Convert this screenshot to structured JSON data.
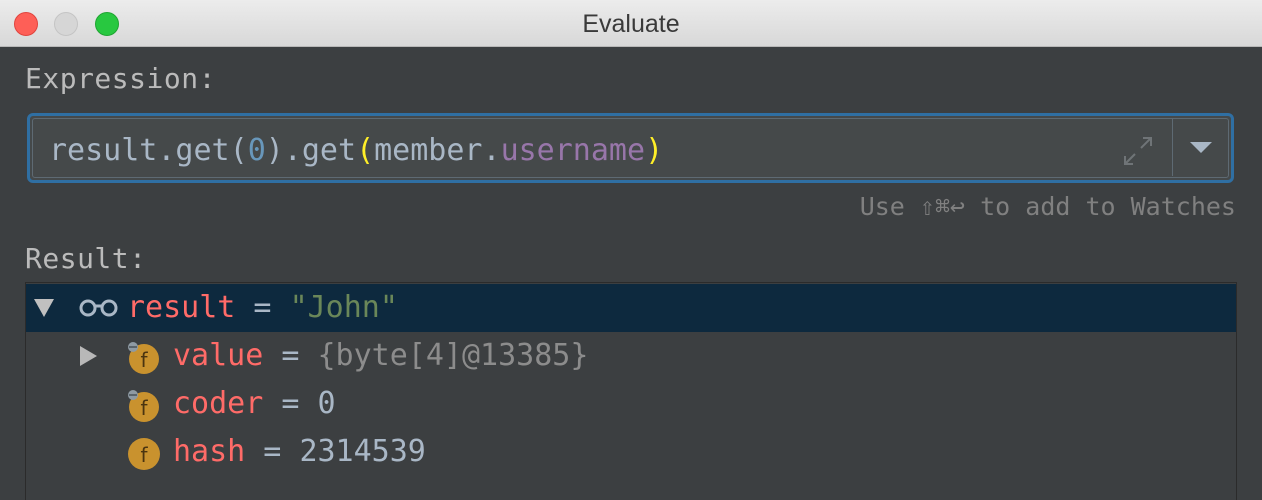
{
  "window": {
    "title": "Evaluate"
  },
  "expression": {
    "label": "Expression:",
    "tokens": {
      "t1": "result.get(",
      "t2": "0",
      "t3": ").get",
      "t4": "(",
      "t5": "member.",
      "t6": "username",
      "t7": ")"
    },
    "hint": "Use ⇧⌘↩ to add to Watches"
  },
  "result": {
    "label": "Result:",
    "root": {
      "name": "result",
      "eq": " = ",
      "value": "\"John\"",
      "expanded": true,
      "icon": "watch-glasses-icon"
    },
    "children": [
      {
        "name": "value",
        "eq": " = ",
        "value": "{byte[4]@13385}",
        "icon": "final-field-icon",
        "expandable": true
      },
      {
        "name": "coder",
        "eq": " = ",
        "value": "0",
        "icon": "final-field-icon"
      },
      {
        "name": "hash",
        "eq": " = ",
        "value": "2314539",
        "icon": "field-icon"
      }
    ]
  },
  "colors": {
    "accent": "#2f6fa3",
    "selection": "#0d293e",
    "field_name": "#ff6b68",
    "string": "#6a8759",
    "number_token": "#6897bb",
    "paren_highlight": "#ffef28",
    "member_field": "#9876aa",
    "field_icon": "#c9922e"
  }
}
